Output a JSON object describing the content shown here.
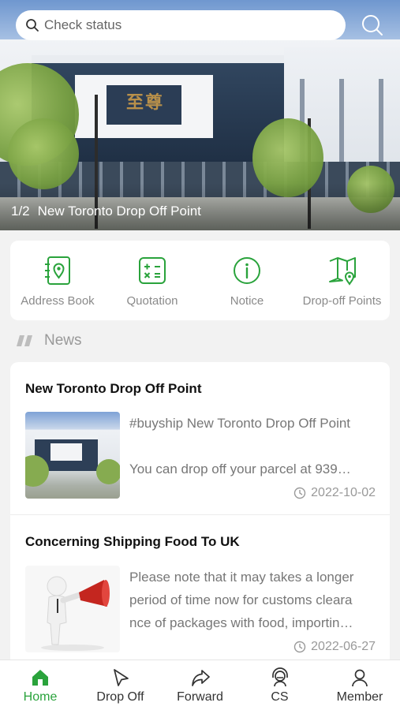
{
  "search": {
    "placeholder": "Check status"
  },
  "banner": {
    "index": "1/2",
    "caption": "New Toronto Drop Off Point"
  },
  "quick_actions": [
    {
      "label": "Address Book",
      "icon": "address-book-icon"
    },
    {
      "label": "Quotation",
      "icon": "calculator-icon"
    },
    {
      "label": "Notice",
      "icon": "info-icon"
    },
    {
      "label": "Drop-off Points",
      "icon": "map-pin-icon"
    }
  ],
  "news": {
    "title": "News",
    "items": [
      {
        "title": "New Toronto Drop Off Point",
        "line1": "#buyship New Toronto Drop Off Point",
        "line2": "You can drop off your parcel at 939…",
        "date": "2022-10-02"
      },
      {
        "title": "Concerning Shipping Food To UK",
        "line1": "Please note that it may takes a longer",
        "line2": "period of time now for customs cleara",
        "line3": "nce of packages with food, importin…",
        "date": "2022-06-27"
      }
    ]
  },
  "tabs": [
    {
      "label": "Home",
      "icon": "home-icon",
      "active": true
    },
    {
      "label": "Drop Off",
      "icon": "cursor-icon"
    },
    {
      "label": "Forward",
      "icon": "forward-icon"
    },
    {
      "label": "CS",
      "icon": "headset-icon"
    },
    {
      "label": "Member",
      "icon": "user-icon"
    }
  ],
  "colors": {
    "accent": "#2aa33c",
    "background": "#f2f2f2"
  }
}
